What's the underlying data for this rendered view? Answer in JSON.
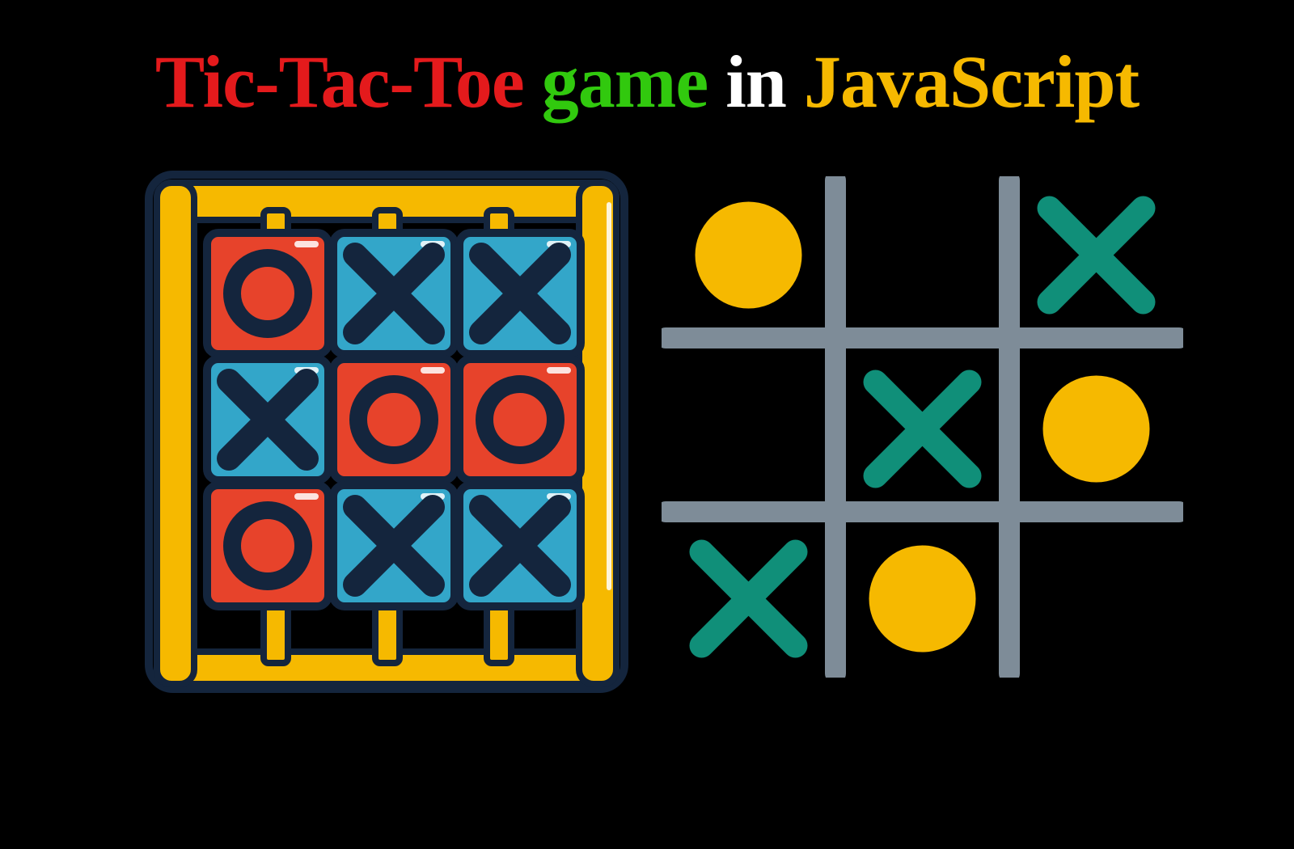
{
  "title": {
    "part1": "Tic-Tac-Toe",
    "part2": "game",
    "part3": "in",
    "part4": "JavaScript"
  },
  "colors": {
    "red": "#e41a1c",
    "green": "#31c90e",
    "white": "#ffffff",
    "yellow": "#f6b900",
    "frame_yellow": "#f6b900",
    "frame_outline": "#14253d",
    "tile_blue": "#33a6c9",
    "tile_red": "#e7432b",
    "mark_dark": "#14253d",
    "grid_grey": "#7e8c98",
    "mark_teal": "#108f79",
    "circle_yellow": "#f6b900"
  },
  "left_board": {
    "grid": [
      [
        "O",
        "X",
        "X"
      ],
      [
        "X",
        "O",
        "O"
      ],
      [
        "O",
        "X",
        "X"
      ]
    ],
    "tile_bg_for": {
      "O": "tile_red",
      "X": "tile_blue"
    }
  },
  "right_board": {
    "grid": [
      [
        "O",
        "",
        "X"
      ],
      [
        "",
        "X",
        "O"
      ],
      [
        "X",
        "O",
        ""
      ]
    ],
    "o_color": "circle_yellow",
    "x_color": "mark_teal"
  }
}
